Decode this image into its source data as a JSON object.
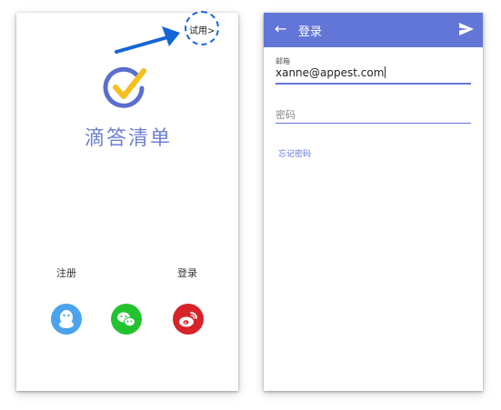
{
  "left_screen": {
    "trial_label": "试用>",
    "brand_name": "滴答清单",
    "register_label": "注册",
    "login_label": "登录",
    "social_icons": [
      "qq-icon",
      "wechat-icon",
      "weibo-icon"
    ],
    "annotation_color": "#1565d8"
  },
  "right_screen": {
    "title": "登录",
    "email_label": "邮箱",
    "email_value": "xanne@appest.com",
    "password_placeholder": "密码",
    "forgot_password": "忘记密码",
    "accent_color": "#6276d8"
  }
}
